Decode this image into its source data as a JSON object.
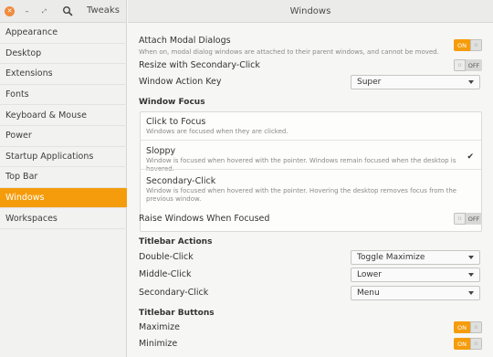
{
  "app": {
    "title": "Tweaks"
  },
  "page": {
    "title": "Windows"
  },
  "sidebar": {
    "items": [
      {
        "label": "Appearance"
      },
      {
        "label": "Desktop"
      },
      {
        "label": "Extensions"
      },
      {
        "label": "Fonts"
      },
      {
        "label": "Keyboard & Mouse"
      },
      {
        "label": "Power"
      },
      {
        "label": "Startup Applications"
      },
      {
        "label": "Top Bar"
      },
      {
        "label": "Windows",
        "active": true
      },
      {
        "label": "Workspaces"
      }
    ]
  },
  "settings": {
    "attach_modal": {
      "label": "Attach Modal Dialogs",
      "desc": "When on, modal dialog windows are attached to their parent windows, and cannot be moved.",
      "state": "ON"
    },
    "resize_secondary": {
      "label": "Resize with Secondary-Click",
      "state": "OFF"
    },
    "action_key": {
      "label": "Window Action Key",
      "value": "Super"
    },
    "raise_focused": {
      "label": "Raise Windows When Focused",
      "state": "OFF"
    }
  },
  "window_focus": {
    "heading": "Window Focus",
    "options": [
      {
        "title": "Click to Focus",
        "desc": "Windows are focused when they are clicked."
      },
      {
        "title": "Sloppy",
        "desc": "Window is focused when hovered with the pointer. Windows remain focused when the desktop is hovered.",
        "selected": true
      },
      {
        "title": "Secondary-Click",
        "desc": "Window is focused when hovered with the pointer. Hovering the desktop removes focus from the previous window."
      }
    ],
    "check_glyph": "✔"
  },
  "titlebar_actions": {
    "heading": "Titlebar Actions",
    "double_click": {
      "label": "Double-Click",
      "value": "Toggle Maximize"
    },
    "middle_click": {
      "label": "Middle-Click",
      "value": "Lower"
    },
    "secondary_click": {
      "label": "Secondary-Click",
      "value": "Menu"
    }
  },
  "titlebar_buttons": {
    "heading": "Titlebar Buttons",
    "maximize": {
      "label": "Maximize",
      "state": "ON"
    },
    "minimize": {
      "label": "Minimize",
      "state": "ON"
    }
  },
  "colors": {
    "accent": "#f59c0c",
    "close": "#f28a3a"
  },
  "icons": {
    "close": "close-icon",
    "minimize": "minimize-icon",
    "maximize": "maximize-icon",
    "search": "search-icon",
    "toggle_knob": "grip-icon"
  }
}
